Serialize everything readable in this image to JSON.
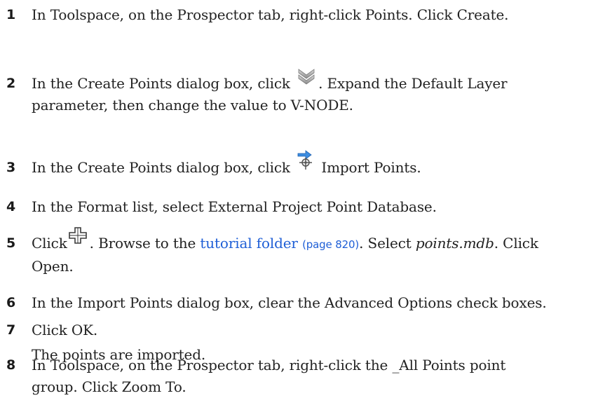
{
  "steps": [
    {
      "num": "1",
      "text": "In Toolspace, on the Prospector tab, right-click Points. Click Create."
    },
    {
      "num": "2",
      "line1_before": "In the Create Points dialog box, click",
      "line1_after": ". Expand the Default Layer",
      "line2": "parameter, then change the value to V-NODE."
    },
    {
      "num": "3",
      "before": "In the Create Points dialog box, click",
      "after": "Import Points."
    },
    {
      "num": "4",
      "text": "In the Format list, select External Project Point Database."
    },
    {
      "num": "5",
      "line1_before": "Click",
      "line1_mid": ". Browse to the",
      "link_text": "tutorial folder",
      "page_ref": "(page 820)",
      "line1_sel": ". Select",
      "file_name": "points.mdb",
      "line1_end": ". Click",
      "line2": "Open."
    },
    {
      "num": "6",
      "text": "In the Import Points dialog box, clear the Advanced Options check boxes."
    },
    {
      "num": "7",
      "text": "Click OK.",
      "result": "The points are imported."
    },
    {
      "num": "8",
      "line1": "In Toolspace, on the Prospector tab, right-click the _All Points point",
      "line2": "group. Click Zoom To."
    }
  ],
  "icons": {
    "step2": "expand-chevrons-icon",
    "step3": "import-points-icon",
    "step5": "add-file-icon"
  }
}
